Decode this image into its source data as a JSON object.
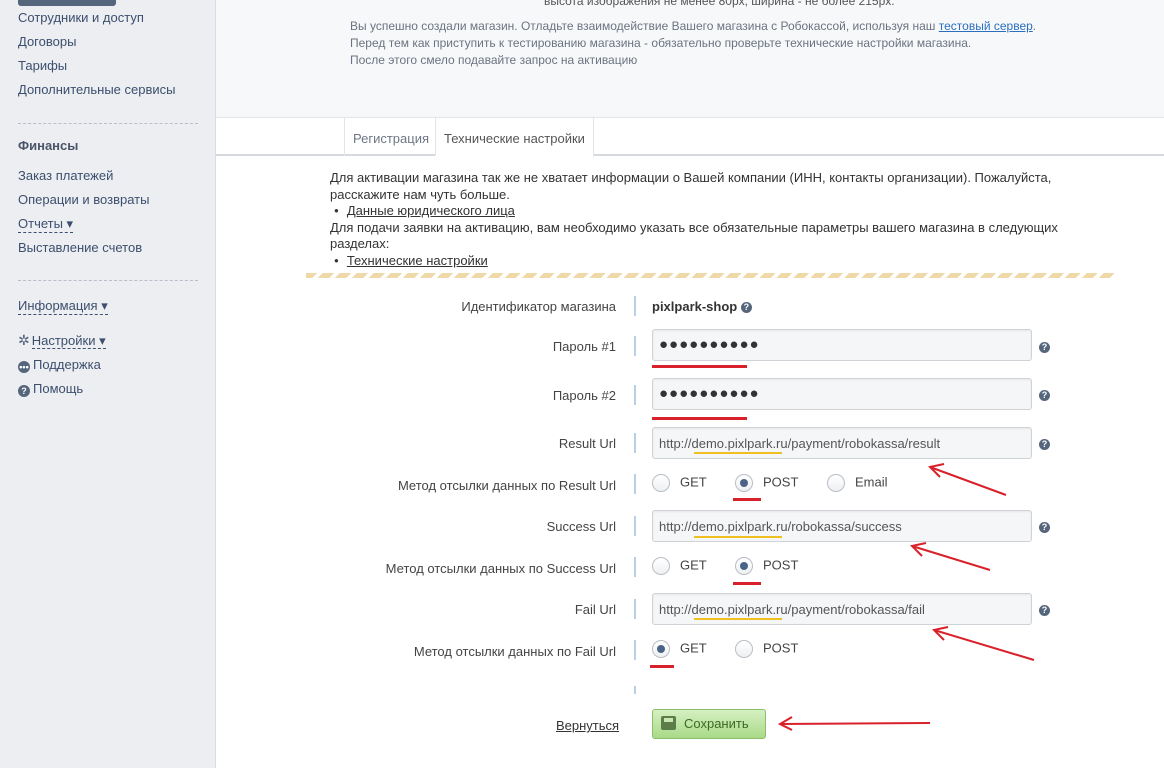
{
  "sidebar": {
    "items_top": [
      "Сотрудники и доступ",
      "Договоры",
      "Тарифы",
      "Дополнительные сервисы"
    ],
    "finance_heading": "Финансы",
    "finance_items": [
      "Заказ платежей",
      "Операции и возвраты"
    ],
    "reports_label": "Отчеты ▾",
    "invoicing_label": "Выставление счетов",
    "info_label": "Информация ▾",
    "settings_label": "Настройки ▾",
    "support_label": "Поддержка",
    "help_label": "Помощь"
  },
  "notice": {
    "cut_line": "высота изображения не менее 80px, ширина - не более 215px.",
    "line1_prefix": "Вы успешно создали магазин. Отладьте взаимодействие Вашего магазина с Робокассой, используя наш ",
    "line1_link": "тестовый сервер",
    "line1_suffix": ".",
    "line2": "Перед тем как приступить к тестированию магазина - обязательно проверьте технические настройки магазина.",
    "line3": "После этого смело подавайте запрос на активацию"
  },
  "tabs": [
    {
      "label": "Регистрация"
    },
    {
      "label": "Технические настройки"
    }
  ],
  "activation": {
    "text1": "Для активации магазина так же не хватает информации о Вашей компании (ИНН, контакты организации). Пожалуйста, расскажите нам чуть больше.",
    "link1": "Данные юридического лица",
    "text2": "Для подачи заявки на активацию, вам необходимо указать все обязательные параметры вашего магазина в следующих разделах:",
    "link2": "Технические настройки"
  },
  "form": {
    "shop_id_label": "Идентификатор магазина",
    "shop_id_value": "pixlpark-shop",
    "password1_label": "Пароль #1",
    "password1_value": "●●●●●●●●●●",
    "password2_label": "Пароль #2",
    "password2_value": "●●●●●●●●●●",
    "result_url_label": "Result Url",
    "result_url_value": "http://demo.pixlpark.ru/payment/robokassa/result",
    "result_method_label": "Метод отсылки данных по Result Url",
    "result_methods": [
      "GET",
      "POST",
      "Email"
    ],
    "result_method_selected": "POST",
    "success_url_label": "Success Url",
    "success_url_value": "http://demo.pixlpark.ru/robokassa/success",
    "success_method_label": "Метод отсылки данных по Success Url",
    "success_methods": [
      "GET",
      "POST"
    ],
    "success_method_selected": "POST",
    "fail_url_label": "Fail Url",
    "fail_url_value": "http://demo.pixlpark.ru/payment/robokassa/fail",
    "fail_method_label": "Метод отсылки данных по Fail Url",
    "fail_methods": [
      "GET",
      "POST"
    ],
    "fail_method_selected": "GET",
    "help_glyph": "?",
    "back_label": "Вернуться",
    "save_label": "Сохранить"
  },
  "colors": {
    "annotation_red": "#d8212a",
    "annotation_yellow": "#f0c020",
    "save_green": "#a9da88",
    "sidebar_link": "#3c4f6e"
  }
}
